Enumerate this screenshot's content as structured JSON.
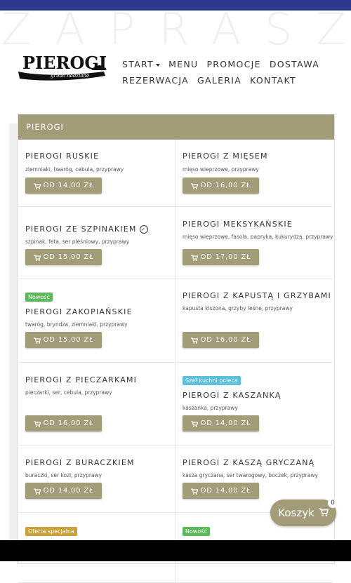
{
  "topbar_color": "#2b3a8f",
  "watermark": "ZAPRASZ",
  "logo": {
    "name": "PIEROGI",
    "tagline": "grubo nadziane"
  },
  "nav": {
    "row1": [
      "START",
      "MENU",
      "PROMOCJE",
      "DOSTAWA"
    ],
    "row2": [
      "REZERWACJA",
      "GALERIA",
      "KONTAKT"
    ]
  },
  "section_title": "PIEROGI",
  "accent_color": "#a39c78",
  "items": [
    {
      "title": "PIEROGI RUSKIE",
      "desc": "ziemniaki, twaróg, cebula, przyprawy",
      "price": "OD 14,00 ZŁ"
    },
    {
      "title": "PIEROGI Z MIĘSEM",
      "desc": "mięso wieprzowe, przyprawy",
      "price": "OD 16,00 ZŁ"
    },
    {
      "title": "PIEROGI ZE SZPINAKIEM",
      "desc": "szpinak, feta, ser pleśniowy, przyprawy",
      "price": "OD 15,00 ZŁ",
      "icon": "vegetarian-leaf-icon"
    },
    {
      "title": "PIEROGI MEKSYKAŃSKIE",
      "desc": "mięso wieprzowe, fasola, papryka, kukurydza, przyprawy",
      "price": "OD 17,00 ZŁ"
    },
    {
      "title": "PIEROGI ZAKOPIAŃSKIE",
      "desc": "twaróg, bryndza, ziemniaki, przyprawy",
      "price": "OD 15,00 ZŁ",
      "badge": "Nowość",
      "badge_color": "#5cb85c"
    },
    {
      "title": "PIEROGI Z KAPUSTĄ I GRZYBAMI",
      "desc": "kapusta kiszona, grzyby leśne, przyprawy",
      "price": "OD 16,00 ZŁ"
    },
    {
      "title": "PIEROGI Z PIECZARKAMI",
      "desc": "pieczarki, ser, cebula, przyprawy",
      "price": "OD 16,00 ZŁ"
    },
    {
      "title": "PIEROGI Z KASZANKĄ",
      "desc": "kaszanka, przyprawy",
      "price": "OD 14,00 ZŁ",
      "badge": "Szef kuchni poleca",
      "badge_color": "#5bc0de"
    },
    {
      "title": "PIEROGI Z BURACZKIEM",
      "desc": "buraczki, ser kozi, przyprawy",
      "price": "OD 14,00 ZŁ"
    },
    {
      "title": "PIEROGI Z KASZĄ GRYCZANĄ",
      "desc": "kasza gryczana, ser twarogowy, boczek, przyprawy",
      "price": "OD 14,00 ZŁ"
    },
    {
      "badge": "Oferta specjalna",
      "badge_color": "#c9a13a"
    },
    {
      "badge": "Nowość",
      "badge_color": "#5cb85c"
    }
  ],
  "cart": {
    "label": "Koszyk",
    "count": "0"
  }
}
